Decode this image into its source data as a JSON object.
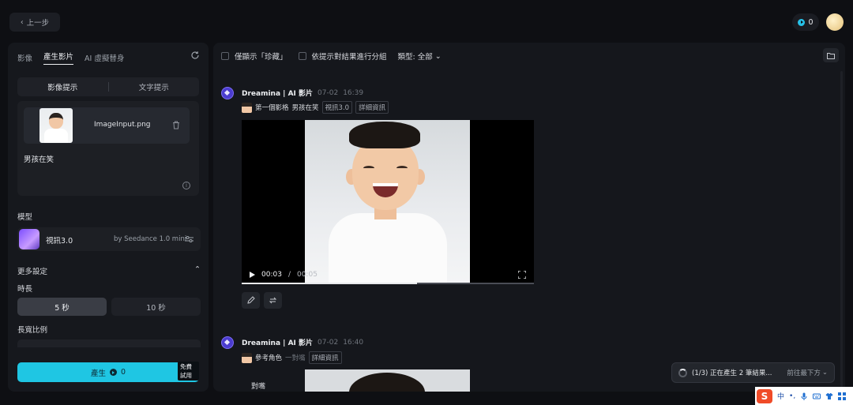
{
  "topbar": {
    "back_label": "上一步",
    "credits": "0"
  },
  "left_panel": {
    "tabs": [
      {
        "label": "影像",
        "active": false
      },
      {
        "label": "產生影片",
        "active": true
      },
      {
        "label": "AI 虛擬替身",
        "active": false
      }
    ],
    "prompt_modes": [
      {
        "label": "影像提示",
        "active": true
      },
      {
        "label": "文字提示",
        "active": false
      }
    ],
    "upload": {
      "file_name": "ImageInput.png"
    },
    "prompt_text": "男孩在笑",
    "info_glyph": "i",
    "model": {
      "section_label": "模型",
      "name": "視訊3.0",
      "subtitle": "by Seedance 1.0 mini"
    },
    "more_settings": {
      "label": "更多設定",
      "duration_label": "時長",
      "durations": [
        {
          "label": "5 秒",
          "active": true
        },
        {
          "label": "10 秒",
          "active": false
        }
      ],
      "ratio_label": "長寬比例"
    },
    "generate": {
      "label": "產生",
      "credits": "0",
      "badge": "免費試用"
    }
  },
  "main_panel": {
    "filters": {
      "favorites_only": "僅顯示「珍藏」",
      "group_by_prompt": "依提示對結果進行分組",
      "type_select": "類型: 全部"
    },
    "entries": [
      {
        "source": "Dreamina | AI 影片",
        "date": "07-02",
        "time": "16:39",
        "ref_label": "第一個影格",
        "prompt": "男孩在笑",
        "model_tag": "視訊3.0",
        "details_tag": "詳細資訊",
        "player": {
          "current": "00:03",
          "separator": "/",
          "duration": "00:05",
          "progress": 0.6
        }
      },
      {
        "source": "Dreamina | AI 影片",
        "date": "07-02",
        "time": "16:40",
        "ref_label": "參考角色",
        "mode_tag": "一對嘴",
        "details_tag": "詳細資訊",
        "body_label": "對嘴"
      }
    ],
    "toast": {
      "status": "(1/3) 正在產生 2 筆結果...",
      "link": "前往最下方"
    }
  },
  "ime_bar": {
    "logo": "S",
    "lang": "中",
    "punct": "•,"
  },
  "colors": {
    "accent": "#1fc6e3",
    "background": "#0e0f13",
    "panel": "#16181d",
    "logo_purple": "#4b3ccf"
  }
}
